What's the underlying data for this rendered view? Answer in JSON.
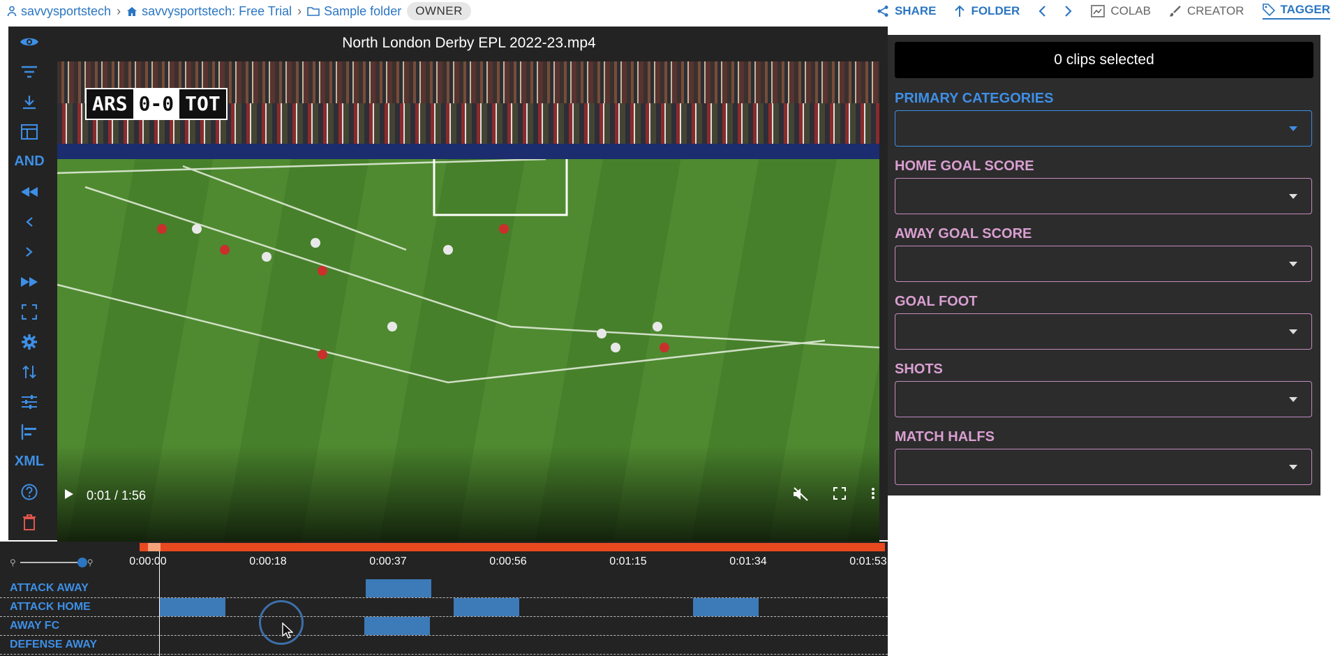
{
  "breadcrumb": {
    "user": "savvysportstech",
    "workspace": "savvysportstech: Free Trial",
    "folder": "Sample folder",
    "role": "OWNER"
  },
  "actions": {
    "share": "SHARE",
    "folder": "FOLDER",
    "colab": "COLAB",
    "creator": "CREATOR",
    "tagger": "TAGGER"
  },
  "toolbar": {
    "and_label": "AND",
    "xml_label": "XML"
  },
  "video": {
    "title": "North London Derby EPL 2022-23.mp4",
    "score_home": "ARS",
    "score_mid": "0-0",
    "score_away": "TOT",
    "time": "0:01 / 1:56"
  },
  "panel": {
    "clips_selected": "0 clips selected",
    "fields": [
      {
        "label": "PRIMARY CATEGORIES"
      },
      {
        "label": "HOME GOAL SCORE"
      },
      {
        "label": "AWAY GOAL SCORE"
      },
      {
        "label": "GOAL FOOT"
      },
      {
        "label": "SHOTS"
      },
      {
        "label": "MATCH HALFS"
      }
    ]
  },
  "timeline": {
    "ticks": [
      "0:00:00",
      "0:00:18",
      "0:00:37",
      "0:00:56",
      "0:01:15",
      "0:01:34",
      "0:01:53"
    ],
    "tracks": [
      {
        "label": "ATTACK AWAY"
      },
      {
        "label": "ATTACK HOME"
      },
      {
        "label": "AWAY FC"
      },
      {
        "label": "DEFENSE AWAY"
      }
    ]
  },
  "colors": {
    "accent": "#2b76c2",
    "timeline_bar": "#e8491f",
    "clip": "#3d7ab8",
    "field_border": "#c58cc0"
  }
}
